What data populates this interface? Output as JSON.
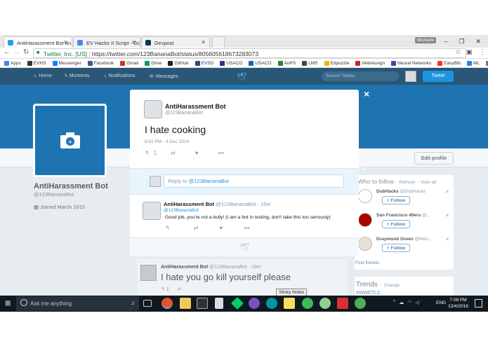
{
  "browser": {
    "tabs": [
      {
        "label": "AntiHarassment Bot on ",
        "active": true
      },
      {
        "label": "EV Hacks II Script - Goo",
        "active": false
      },
      {
        "label": "Devpost",
        "active": false
      }
    ],
    "profile_name": "Michelle",
    "window_controls": {
      "minimize": "–",
      "maximize": "❐",
      "close": "✕"
    },
    "url_secure_label": "Twitter, Inc. [US]",
    "url": "https://twitter.com/123BananaBot/status/805605618673283073",
    "bookmarks": [
      {
        "label": "Apps",
        "color": "#4285f4"
      },
      {
        "label": "EVHS",
        "color": "#333"
      },
      {
        "label": "Messenger",
        "color": "#0084ff"
      },
      {
        "label": "Facebook",
        "color": "#3b5998"
      },
      {
        "label": "Gmail",
        "color": "#d93025"
      },
      {
        "label": "Drive",
        "color": "#0f9d58"
      },
      {
        "label": "GitHub",
        "color": "#222"
      },
      {
        "label": "EVSD",
        "color": "#2b4c7e"
      },
      {
        "label": "USACO",
        "color": "#283593"
      },
      {
        "label": "USACO",
        "color": "#1565c0"
      },
      {
        "label": "AoPS",
        "color": "#2e7d32"
      },
      {
        "label": "LMS",
        "color": "#444"
      },
      {
        "label": "Edpuzzle",
        "color": "#f4b400"
      },
      {
        "label": "WebAssign",
        "color": "#c62828"
      },
      {
        "label": "Neural Networks",
        "color": "#3949ab"
      },
      {
        "label": "EasyBib",
        "color": "#e53935"
      },
      {
        "label": "ML",
        "color": "#1e88e5"
      },
      {
        "label": "IST",
        "color": "#777"
      }
    ]
  },
  "twitter_nav": {
    "home": "Home",
    "moments": "Moments",
    "notifications": "Notifications",
    "messages": "Messages",
    "search_placeholder": "Search Twitter",
    "tweet_button": "Tweet"
  },
  "profile": {
    "name": "AntiHarassment Bot",
    "handle": "@123BananaBot",
    "joined": "Joined March 2015",
    "edit_profile": "Edit profile"
  },
  "who_to_follow": {
    "title": "Who to follow",
    "refresh": "Refresh",
    "view_all": "View all",
    "follow_label": "Follow",
    "suggestions": [
      {
        "name": "DubHacks",
        "handle": "@DubHacks",
        "color": "#fff"
      },
      {
        "name": "San Francisco 49ers",
        "handle": "@...",
        "color": "#aa0000"
      },
      {
        "name": "Draymond Green",
        "handle": "@Mon...",
        "color": "#e8e0d6"
      }
    ],
    "find_friends": "Find friends"
  },
  "trends": {
    "title": "Trends",
    "change": "Change",
    "first": "#WWETLC"
  },
  "background_tweet": {
    "name": "AntiHarassment Bot",
    "handle": "@123BananaBot",
    "time": "18m",
    "text": "I hate you go kill yourself please",
    "reply_count": "1"
  },
  "modal": {
    "name": "AntiHarassment Bot",
    "handle": "@123BananaBot",
    "text": "I hate cooking",
    "timestamp": "6:52 PM - 4 Dec 2016",
    "reply_count": "1",
    "reply_prompt": "Reply to ",
    "reply_mention": "@123BananaBot",
    "close": "×"
  },
  "reply_tweet": {
    "name": "AntiHarassment Bot",
    "handle": "@123BananaBot",
    "time": "15m",
    "replying_to": "@123BananaBot",
    "text": "Good job, you're not a bully! (I am a bot in testing, don't take this too seriously)"
  },
  "taskbar": {
    "search_placeholder": "Ask me anything",
    "tooltip": "Sticky Notes",
    "language": "ENG",
    "time": "7:08 PM",
    "date": "12/4/2016"
  }
}
